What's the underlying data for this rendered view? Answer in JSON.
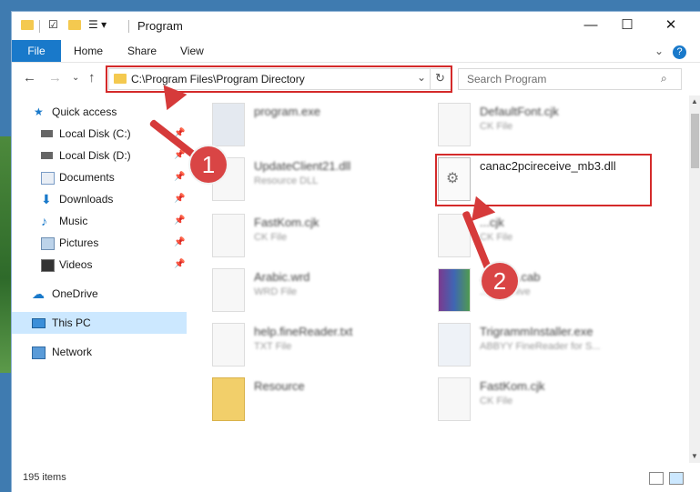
{
  "window": {
    "title": "Program",
    "buttons": {
      "minimize": "—",
      "maximize": "☐",
      "close": "✕"
    }
  },
  "ribbon": {
    "tabs": [
      "File",
      "Home",
      "Share",
      "View"
    ],
    "expand_icon": "chevron-down-icon",
    "help": "?"
  },
  "address": {
    "path": "C:\\Program Files\\Program Directory",
    "search_placeholder": "Search Program"
  },
  "sidebar": {
    "items": [
      {
        "label": "Quick access",
        "icon": "star-icon"
      },
      {
        "label": "Local Disk (C:)",
        "icon": "drive-icon",
        "pinned": true
      },
      {
        "label": "Local Disk (D:)",
        "icon": "drive-icon",
        "pinned": true
      },
      {
        "label": "Documents",
        "icon": "documents-icon",
        "pinned": true
      },
      {
        "label": "Downloads",
        "icon": "downloads-icon",
        "pinned": true
      },
      {
        "label": "Music",
        "icon": "music-icon",
        "pinned": true
      },
      {
        "label": "Pictures",
        "icon": "pictures-icon",
        "pinned": true
      },
      {
        "label": "Videos",
        "icon": "videos-icon",
        "pinned": true
      },
      {
        "label": "OneDrive",
        "icon": "cloud-icon"
      },
      {
        "label": "This PC",
        "icon": "pc-icon",
        "selected": true
      },
      {
        "label": "Network",
        "icon": "network-icon"
      }
    ]
  },
  "files": [
    {
      "name": "program.exe",
      "sub": ""
    },
    {
      "name": "DefaultFont.cjk",
      "sub": "CK File"
    },
    {
      "name": "UpdateClient21.dll",
      "sub": "Resource DLL"
    },
    {
      "name": "canac2pcireceive_mb3.dll",
      "sub": ""
    },
    {
      "name": "FastKom.cjk",
      "sub": "CK File"
    },
    {
      "name": "...cjk",
      "sub": "CK File"
    },
    {
      "name": "Arabic.wrd",
      "sub": "WRD File"
    },
    {
      "name": "...cates.cab",
      "sub": "...E Archive"
    },
    {
      "name": "help.fineReader.txt",
      "sub": "TXT File"
    },
    {
      "name": "TrigrammInstaller.exe",
      "sub": "ABBYY FineReader for S..."
    },
    {
      "name": "Resource",
      "sub": ""
    },
    {
      "name": "FastKom.cjk",
      "sub": "CK File"
    }
  ],
  "status": {
    "item_count": "195 items"
  },
  "callouts": [
    "1",
    "2"
  ],
  "colors": {
    "accent": "#1979ca",
    "highlight": "#d42a2a",
    "selected": "#cce8ff"
  }
}
